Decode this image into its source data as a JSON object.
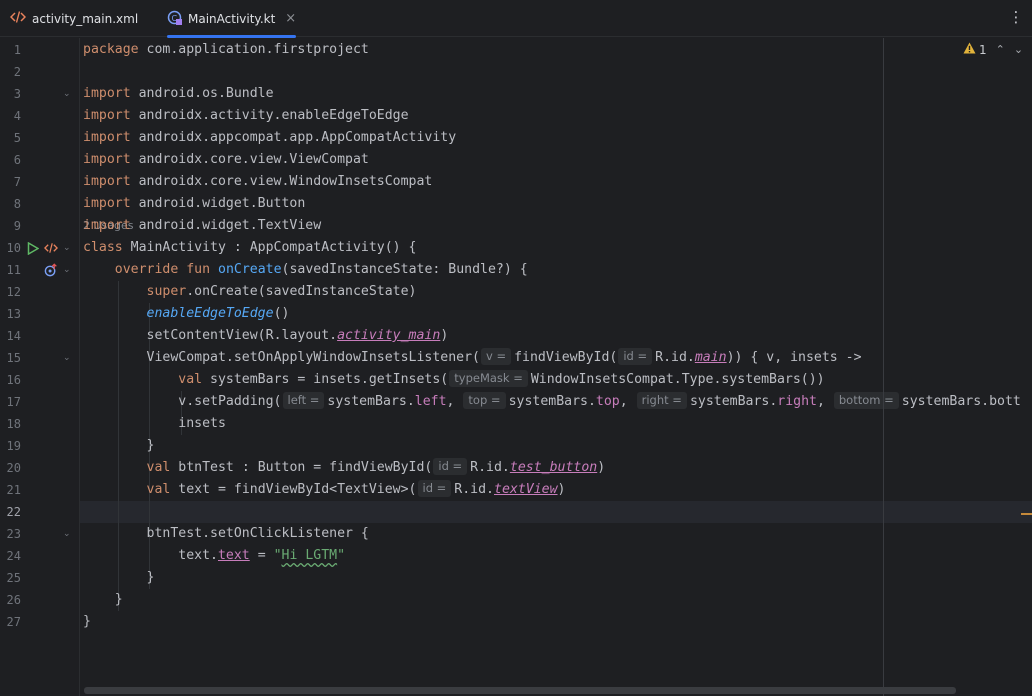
{
  "tabs": [
    {
      "label": "activity_main.xml",
      "icon": "xml-file-icon",
      "active": false
    },
    {
      "label": "MainActivity.kt",
      "icon": "kotlin-file-icon",
      "active": true,
      "close": "×"
    }
  ],
  "more_menu": "⋮",
  "inspection": {
    "warning_count": "1",
    "prev": "⌃",
    "next": "⌄"
  },
  "usages_hint": "2 Usages",
  "current_line": 22,
  "line_numbers": [
    "1",
    "2",
    "3",
    "4",
    "5",
    "6",
    "7",
    "8",
    "9",
    "10",
    "11",
    "12",
    "13",
    "14",
    "15",
    "16",
    "17",
    "18",
    "19",
    "20",
    "21",
    "22",
    "23",
    "24",
    "25",
    "26",
    "27"
  ],
  "code": {
    "l1": {
      "kw": "package",
      "rest": " com.application.firstproject"
    },
    "l3": {
      "kw": "import",
      "rest": " android.os.Bundle"
    },
    "l4": {
      "kw": "import",
      "rest": " androidx.activity.enableEdgeToEdge"
    },
    "l5": {
      "kw": "import",
      "rest": " androidx.appcompat.app.AppCompatActivity"
    },
    "l6": {
      "kw": "import",
      "rest": " androidx.core.view.ViewCompat"
    },
    "l7": {
      "kw": "import",
      "rest": " androidx.core.view.WindowInsetsCompat"
    },
    "l8": {
      "kw": "import",
      "rest": " android.widget.Button"
    },
    "l9": {
      "kw": "import",
      "rest": " android.widget.TextView"
    },
    "l10": {
      "kw": "class",
      "rest": " MainActivity : AppCompatActivity() {"
    },
    "l11": {
      "indent": "    ",
      "kw": "override fun",
      "sp": " ",
      "fn": "onCreate",
      "rest": "(savedInstanceState: Bundle?) {"
    },
    "l12": {
      "indent": "        ",
      "kw": "super",
      "rest": ".onCreate(savedInstanceState)"
    },
    "l13": {
      "indent": "        ",
      "it": "enableEdgeToEdge",
      "rest": "()"
    },
    "l14": {
      "indent": "        ",
      "a": "setContentView(R.layout.",
      "prop": "activity_main",
      "b": ")"
    },
    "l15": {
      "indent": "        ",
      "a": "ViewCompat.setOnApplyWindowInsetsListener(",
      "h1": "v =",
      "b": "findViewById(",
      "h2": "id =",
      "c": "R.id.",
      "prop": "main",
      "d": ")) { v, insets ->"
    },
    "l16": {
      "indent": "            ",
      "kw": "val",
      "a": " systemBars = insets.getInsets(",
      "h1": "typeMask =",
      "b": "WindowInsetsCompat.Type.systemBars())"
    },
    "l17": {
      "indent": "            ",
      "a": "v.setPadding(",
      "h1": "left =",
      "b": "systemBars.",
      "p1": "left",
      "c": ", ",
      "h2": "top =",
      "d": "systemBars.",
      "p2": "top",
      "e": ", ",
      "h3": "right =",
      "f": "systemBars.",
      "p3": "right",
      "g": ", ",
      "h4": "bottom =",
      "i": "systemBars.bott"
    },
    "l18": {
      "indent": "            ",
      "rest": "insets"
    },
    "l19": {
      "indent": "        ",
      "rest": "}"
    },
    "l20": {
      "indent": "        ",
      "kw": "val",
      "a": " btnTest : Button = findViewById(",
      "h1": "id =",
      "b": "R.id.",
      "prop": "test_button",
      "c": ")"
    },
    "l21": {
      "indent": "        ",
      "kw": "val",
      "a": " text = findViewById<TextView>(",
      "h1": "id =",
      "b": "R.id.",
      "prop": "textView",
      "c": ")"
    },
    "l23": {
      "indent": "        ",
      "rest": "btnTest.setOnClickListener {"
    },
    "l24": {
      "indent": "            ",
      "a": "text.",
      "prop": "text",
      "b": " = ",
      "q1": "\"",
      "typo": "Hi LGTM",
      "q2": "\""
    },
    "l25": {
      "indent": "        ",
      "rest": "}"
    },
    "l26": {
      "indent": "    ",
      "rest": "}"
    },
    "l27": {
      "rest": "}"
    }
  },
  "colors": {
    "keyword": "#cf8e6d",
    "function": "#56a8f5",
    "property": "#c77dbb",
    "string": "#6aab73",
    "accent": "#3574f0",
    "warning": "#e2b33b"
  }
}
